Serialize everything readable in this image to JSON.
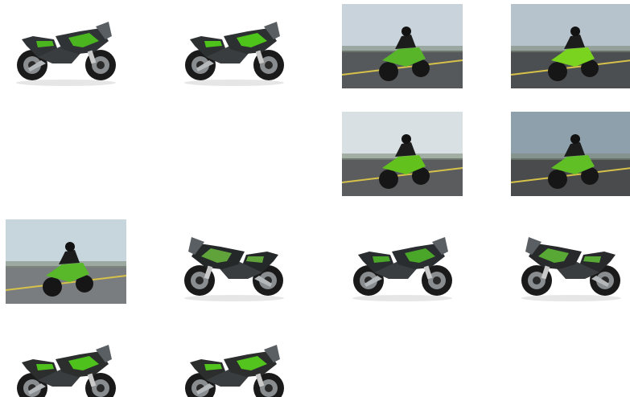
{
  "gallery": {
    "images": [
      {
        "kind": "studio",
        "scene": "motorcycle-studio-black-green",
        "body": "#2f3336",
        "accent": "#4bb51f"
      },
      {
        "kind": "studio",
        "scene": "motorcycle-studio-green-black",
        "body": "#2c3030",
        "accent": "#4ec41a"
      },
      {
        "kind": "action",
        "scene": "rider-city-street",
        "sky": "#c9d3db",
        "ground": "#56595c",
        "accent": "#58b52a"
      },
      {
        "kind": "action",
        "scene": "rider-track-lean",
        "sky": "#b7c3cc",
        "ground": "#4c4f52",
        "accent": "#7ad31f"
      },
      {
        "kind": "empty",
        "scene": "empty"
      },
      {
        "kind": "empty",
        "scene": "empty"
      },
      {
        "kind": "action",
        "scene": "rider-motion-blur-road",
        "sky": "#d9e0e4",
        "ground": "#5a5c5e",
        "accent": "#63c11e"
      },
      {
        "kind": "action",
        "scene": "rider-desert-road",
        "sky": "#8fa0ad",
        "ground": "#4a4b4c",
        "accent": "#5fbf25"
      },
      {
        "kind": "action",
        "scene": "rider-race-circuit",
        "sky": "#c7d6dc",
        "ground": "#7a7d7f",
        "accent": "#59b72a"
      },
      {
        "kind": "studio",
        "scene": "motorcycle-studio-side-black",
        "body": "#252829",
        "accent": "#5fa33a"
      },
      {
        "kind": "studio",
        "scene": "motorcycle-studio-front-black",
        "body": "#2a2d2f",
        "accent": "#4aa629"
      },
      {
        "kind": "studio",
        "scene": "motorcycle-studio-side-black-2",
        "body": "#28292b",
        "accent": "#58a836"
      },
      {
        "kind": "studio",
        "scene": "motorcycle-studio-krt-green",
        "body": "#2b2e2d",
        "accent": "#4fc11c"
      },
      {
        "kind": "studio",
        "scene": "motorcycle-studio-krt-green-2",
        "body": "#2b2e2d",
        "accent": "#53c31e"
      }
    ]
  }
}
